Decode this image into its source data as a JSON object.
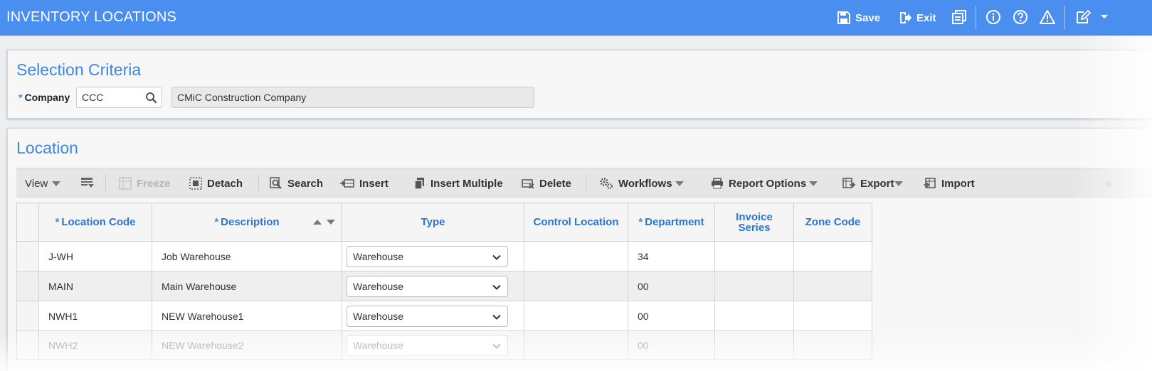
{
  "header": {
    "title": "INVENTORY LOCATIONS",
    "save_label": "Save",
    "exit_label": "Exit"
  },
  "selection": {
    "title": "Selection Criteria",
    "company_label": "Company",
    "company_code": "CCC",
    "company_name": "CMiC Construction Company"
  },
  "location": {
    "title": "Location",
    "toolbar": {
      "view": "View",
      "freeze": "Freeze",
      "detach": "Detach",
      "search": "Search",
      "insert": "Insert",
      "insert_multiple": "Insert Multiple",
      "delete": "Delete",
      "workflows": "Workflows",
      "report_options": "Report Options",
      "export": "Export",
      "import": "Import"
    },
    "columns": {
      "location_code": "Location Code",
      "description": "Description",
      "type": "Type",
      "control_location": "Control Location",
      "department": "Department",
      "invoice_series_1": "Invoice",
      "invoice_series_2": "Series",
      "zone_code": "Zone Code"
    },
    "rows": [
      {
        "code": "J-WH",
        "description": "Job Warehouse",
        "type": "Warehouse",
        "control": "",
        "department": "34",
        "invoice": "",
        "zone": ""
      },
      {
        "code": "MAIN",
        "description": "Main Warehouse",
        "type": "Warehouse",
        "control": "",
        "department": "00",
        "invoice": "",
        "zone": ""
      },
      {
        "code": "NWH1",
        "description": "NEW Warehouse1",
        "type": "Warehouse",
        "control": "",
        "department": "00",
        "invoice": "",
        "zone": ""
      },
      {
        "code": "NWH2",
        "description": "NEW Warehouse2",
        "type": "Warehouse",
        "control": "",
        "department": "00",
        "invoice": "",
        "zone": ""
      }
    ]
  },
  "colors": {
    "header_bg": "#4a8ef0",
    "title_blue": "#3c87e6",
    "column_header_blue": "#2d73cf"
  }
}
